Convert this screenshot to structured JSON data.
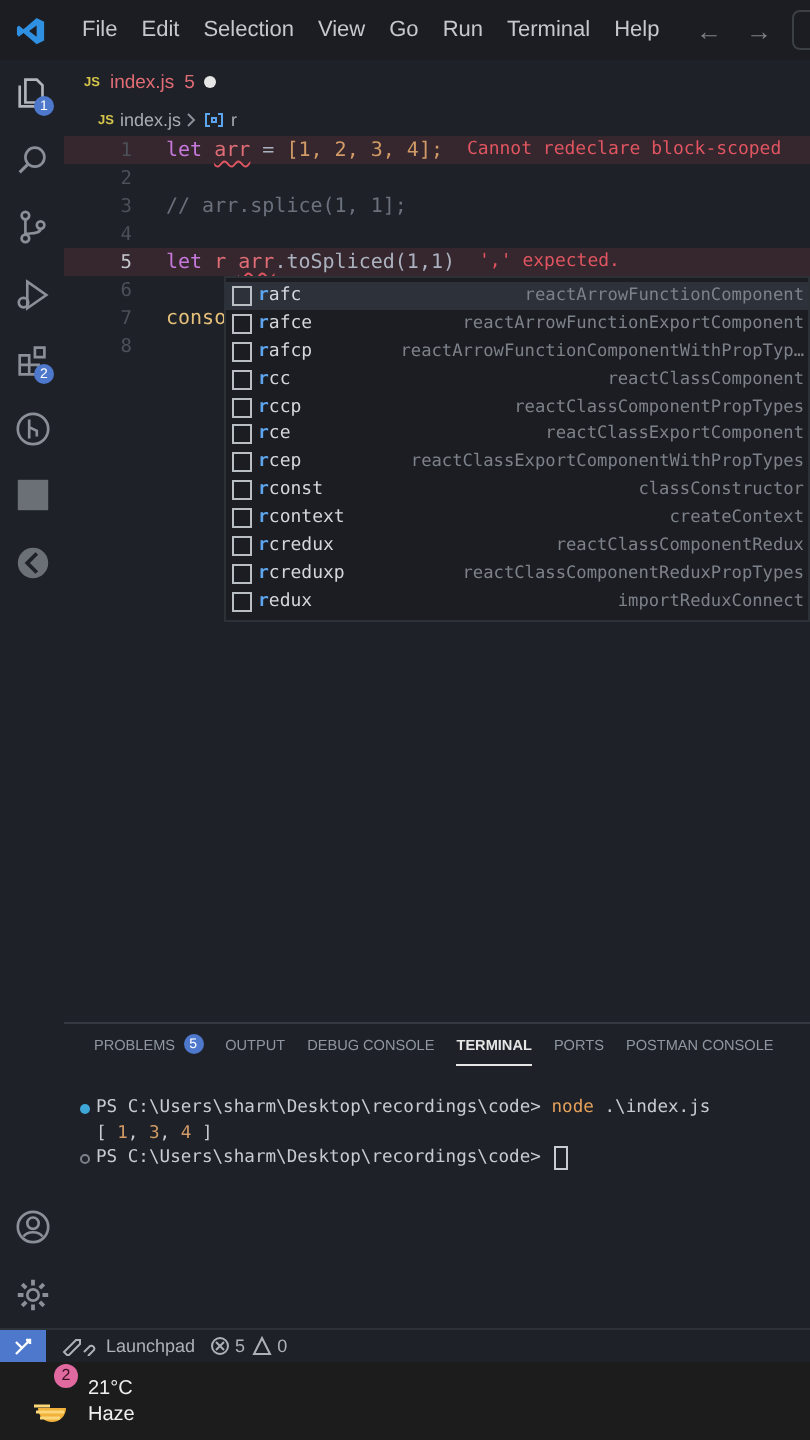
{
  "title_bar": {
    "menu": [
      "File",
      "Edit",
      "Selection",
      "View",
      "Go",
      "Run",
      "Terminal",
      "Help"
    ],
    "nav": [
      "←",
      "→"
    ]
  },
  "activity_bar": {
    "top": [
      {
        "kind": "files",
        "badge": "1"
      },
      {
        "kind": "search"
      },
      {
        "kind": "branch"
      },
      {
        "kind": "debug"
      },
      {
        "kind": "extensions",
        "badge": "2"
      },
      {
        "kind": "graph"
      },
      {
        "kind": "jenv"
      },
      {
        "kind": "arrow"
      }
    ],
    "bottom": [
      {
        "kind": "account"
      },
      {
        "kind": "settings"
      }
    ]
  },
  "editor_tabs": [
    {
      "file_icon": "JS",
      "label": "index.js",
      "badge": "5",
      "modified": true,
      "selected": true
    }
  ],
  "breadcrumb": {
    "file_icon": "JS",
    "file": "index.js",
    "symbol": "r"
  },
  "code_lines": [
    {
      "number": "1",
      "active": false,
      "error": true,
      "tokens": [
        {
          "kind": "keyword",
          "text": "let "
        },
        {
          "kind": "variable",
          "text": "arr",
          "squiggle": true
        },
        {
          "kind": "plain",
          "text": " = "
        },
        {
          "kind": "punct",
          "text": "[1, 2, 3, 4];"
        }
      ],
      "diagnostic": "Cannot redeclare block-scoped"
    },
    {
      "number": "2",
      "active": false,
      "error": false
    },
    {
      "number": "3",
      "active": false,
      "error": false,
      "tokens": [
        {
          "kind": "comment",
          "text": "// arr.splice(1, 1];"
        }
      ]
    },
    {
      "number": "4",
      "active": false,
      "error": false
    },
    {
      "number": "5",
      "active": true,
      "error": true,
      "tokens": [
        {
          "kind": "keyword",
          "text": "let "
        },
        {
          "kind": "variable",
          "text": "r "
        },
        {
          "kind": "variable",
          "text": "arr",
          "squiggle": true
        },
        {
          "kind": "plain",
          "text": ".toSpliced(1,1)"
        }
      ],
      "diagnostic": "',' expected."
    },
    {
      "number": "6",
      "active": false,
      "error": false
    },
    {
      "number": "7",
      "active": false,
      "error": false,
      "tokens": [
        {
          "kind": "function",
          "text": "conso"
        }
      ]
    },
    {
      "number": "8",
      "active": false,
      "error": false
    }
  ],
  "suggestions": [
    {
      "match": "r",
      "rest": "afc",
      "detail": "reactArrowFunctionComponent",
      "selected": true
    },
    {
      "match": "r",
      "rest": "afce",
      "detail": "reactArrowFunctionExportComponent",
      "selected": false
    },
    {
      "match": "r",
      "rest": "afcp",
      "detail": "reactArrowFunctionComponentWithPropTyp…",
      "selected": false
    },
    {
      "match": "r",
      "rest": "cc",
      "detail": "reactClassComponent",
      "selected": false
    },
    {
      "match": "r",
      "rest": "ccp",
      "detail": "reactClassComponentPropTypes",
      "selected": false
    },
    {
      "match": "r",
      "rest": "ce",
      "detail": "reactClassExportComponent",
      "selected": false
    },
    {
      "match": "r",
      "rest": "cep",
      "detail": "reactClassExportComponentWithPropTypes",
      "selected": false
    },
    {
      "match": "r",
      "rest": "const",
      "detail": "classConstructor",
      "selected": false
    },
    {
      "match": "r",
      "rest": "context",
      "detail": "createContext",
      "selected": false
    },
    {
      "match": "r",
      "rest": "credux",
      "detail": "reactClassComponentRedux",
      "selected": false
    },
    {
      "match": "r",
      "rest": "creduxp",
      "detail": "reactClassComponentReduxPropTypes",
      "selected": false
    },
    {
      "match": "r",
      "rest": "edux",
      "detail": "importReduxConnect",
      "selected": false
    }
  ],
  "panel": {
    "tabs": [
      {
        "label": "PROBLEMS",
        "badge": "5",
        "selected": false
      },
      {
        "label": "OUTPUT",
        "selected": false
      },
      {
        "label": "DEBUG CONSOLE",
        "selected": false
      },
      {
        "label": "TERMINAL",
        "selected": true
      },
      {
        "label": "PORTS",
        "selected": false
      },
      {
        "label": "POSTMAN CONSOLE",
        "selected": false
      }
    ],
    "terminal": [
      {
        "kind": "command",
        "tokens": [
          {
            "kind": "plain",
            "text": "PS C:\\Users\\sharm\\Desktop\\recordings\\code> "
          },
          {
            "kind": "command",
            "text": "node"
          },
          {
            "kind": "plain",
            "text": " .\\index.js"
          }
        ]
      },
      {
        "kind": "output",
        "tokens": [
          {
            "kind": "plain",
            "text": "[ "
          },
          {
            "kind": "number",
            "text": "1"
          },
          {
            "kind": "plain",
            "text": ", "
          },
          {
            "kind": "number",
            "text": "3"
          },
          {
            "kind": "plain",
            "text": ", "
          },
          {
            "kind": "number",
            "text": "4"
          },
          {
            "kind": "plain",
            "text": " ]"
          }
        ]
      },
      {
        "kind": "prompt",
        "cursor": true,
        "tokens": [
          {
            "kind": "plain",
            "text": "PS C:\\Users\\sharm\\Desktop\\recordings\\code> "
          }
        ]
      }
    ]
  },
  "status_bar": {
    "launchpad": "Launchpad",
    "errors": "5",
    "warnings": "0"
  },
  "taskbar": {
    "badge": "2",
    "temperature": "21°C",
    "condition": "Haze"
  }
}
